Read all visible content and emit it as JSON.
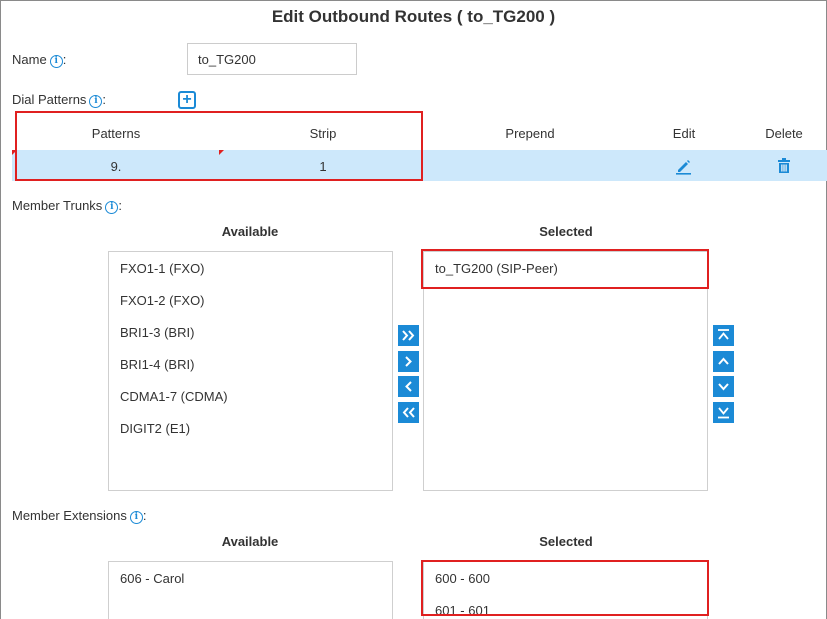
{
  "title": "Edit Outbound Routes ( to_TG200 )",
  "name_field": {
    "label": "Name",
    "colon": ":",
    "value": "to_TG200"
  },
  "dial_patterns": {
    "label": "Dial Patterns",
    "colon": ":",
    "columns": [
      "Patterns",
      "Strip",
      "Prepend",
      "Edit",
      "Delete"
    ],
    "rows": [
      {
        "pattern": "9.",
        "strip": "1",
        "prepend": ""
      }
    ]
  },
  "member_trunks": {
    "label": "Member Trunks",
    "colon": ":",
    "available_heading": "Available",
    "selected_heading": "Selected",
    "available": [
      "FXO1-1 (FXO)",
      "FXO1-2 (FXO)",
      "BRI1-3 (BRI)",
      "BRI1-4 (BRI)",
      "CDMA1-7 (CDMA)",
      "DIGIT2 (E1)"
    ],
    "selected": [
      "to_TG200 (SIP-Peer)"
    ]
  },
  "member_extensions": {
    "label": "Member Extensions",
    "colon": ":",
    "available_heading": "Available",
    "selected_heading": "Selected",
    "available": [
      "606 - Carol"
    ],
    "selected": [
      "600 - 600",
      "601 - 601"
    ]
  },
  "colors": {
    "accent": "#1b8ad6",
    "row_highlight": "#cde8fb",
    "annotation": "#e02020"
  },
  "icons": {
    "info": "info-circle-icon",
    "add": "plus-square-icon",
    "edit": "pencil-icon",
    "delete": "trash-icon",
    "move_all_right": "double-chevron-right-icon",
    "move_right": "chevron-right-icon",
    "move_left": "chevron-left-icon",
    "move_all_left": "double-chevron-left-icon",
    "move_top": "move-to-top-icon",
    "move_up": "chevron-up-icon",
    "move_down": "chevron-down-icon",
    "move_bottom": "move-to-bottom-icon"
  }
}
